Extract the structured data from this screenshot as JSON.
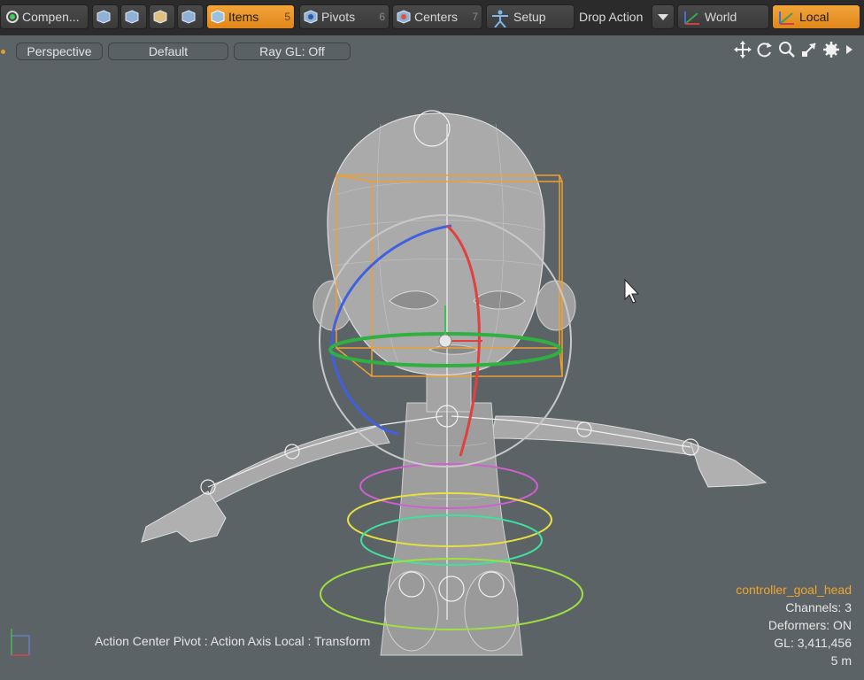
{
  "toolbar": {
    "components_label": "Compen...",
    "items_label": "Items",
    "items_num": "5",
    "pivots_label": "Pivots",
    "pivots_num": "6",
    "centers_label": "Centers",
    "centers_num": "7",
    "setup_label": "Setup",
    "drop_action_label": "Drop Action",
    "world_label": "World",
    "local_label": "Local"
  },
  "viewport": {
    "view_label": "Perspective",
    "shading_label": "Default",
    "raygl_label": "Ray GL: Off"
  },
  "info": {
    "selected": "controller_goal_head",
    "channels": "Channels: 3",
    "deformers": "Deformers: ON",
    "gl": "GL: 3,411,456",
    "scale": "5 m"
  },
  "status": {
    "text": "Action Center Pivot : Action Axis Local : Transform"
  },
  "colors": {
    "accent": "#f0a42c",
    "viewport_bg": "#5c6366",
    "toolbar_bg": "#2b2b2b"
  }
}
